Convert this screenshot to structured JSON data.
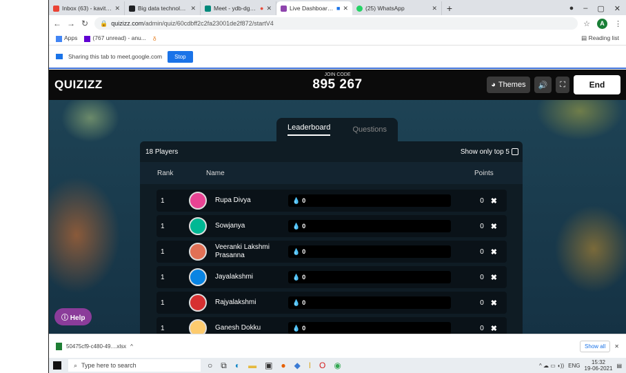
{
  "browser": {
    "tabs": [
      {
        "title": "Inbox (63) - kavitha@abgdcrep...",
        "color": "#ea4335",
        "active": false
      },
      {
        "title": "Big data technologies 20-21",
        "color": "#202124",
        "active": false
      },
      {
        "title": "Meet - ydb-dgzr-oyq",
        "color": "#00897b",
        "active": false
      },
      {
        "title": "Live Dashboard - Running",
        "color": "#8e44ad",
        "active": true
      },
      {
        "title": "(25) WhatsApp",
        "color": "#25d366",
        "active": false
      }
    ],
    "url_host": "quizizz.com",
    "url_path": "/admin/quiz/60cdbff2c2fa23001de2f872/startV4",
    "bookmarks": [
      "Apps",
      "(767 unread) - anu..."
    ],
    "reading_list": "Reading list",
    "profile_initial": "A"
  },
  "share_bar": {
    "text": "Sharing this tab to meet.google.com",
    "stop_label": "Stop"
  },
  "quizizz": {
    "logo": "QUIZIZZ",
    "join_label": "JOIN CODE",
    "join_code": "895 267",
    "themes_label": "Themes",
    "end_label": "End",
    "tab_leaderboard": "Leaderboard",
    "tab_questions": "Questions",
    "players_count": "18 Players",
    "show_top5": "Show only top 5",
    "col_rank": "Rank",
    "col_name": "Name",
    "col_points": "Points",
    "help_label": "Help",
    "players": [
      {
        "rank": "1",
        "name": "Rupa Divya",
        "score": "0",
        "points": "0",
        "color": "#e84393"
      },
      {
        "rank": "1",
        "name": "Sowjanya",
        "score": "0",
        "points": "0",
        "color": "#00b894"
      },
      {
        "rank": "1",
        "name": "Veeranki Lakshmi Prasanna",
        "score": "0",
        "points": "0",
        "color": "#e17055"
      },
      {
        "rank": "1",
        "name": "Jayalakshmi",
        "score": "0",
        "points": "0",
        "color": "#0984e3"
      },
      {
        "rank": "1",
        "name": "Rajyalakshmi",
        "score": "0",
        "points": "0",
        "color": "#d63031"
      },
      {
        "rank": "1",
        "name": "Ganesh Dokku",
        "score": "0",
        "points": "0",
        "color": "#fdcb6e"
      }
    ]
  },
  "download_bar": {
    "file": "50475cf9-c480-49....xlsx",
    "show_all": "Show all"
  },
  "taskbar": {
    "search_placeholder": "Type here to search",
    "lang": "ENG",
    "time": "15:32",
    "date": "19-06-2021"
  }
}
